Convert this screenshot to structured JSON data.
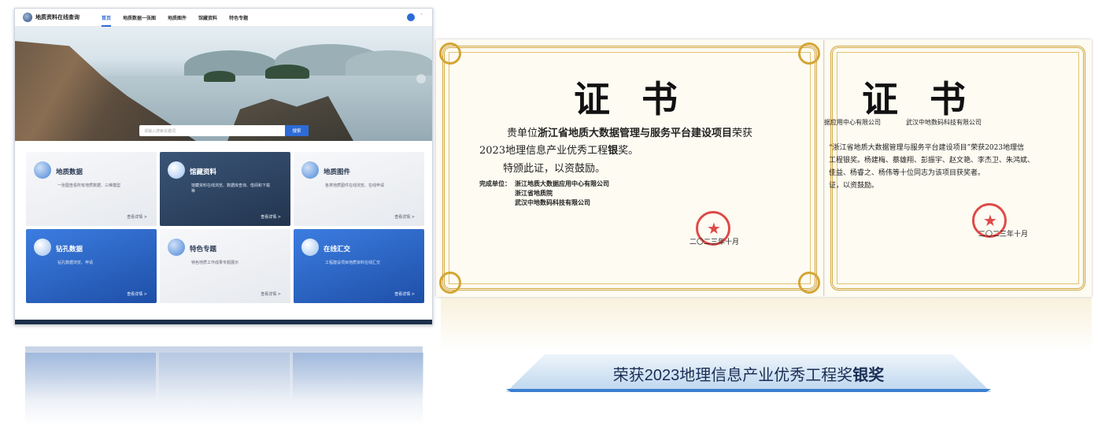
{
  "site": {
    "title": "地质资料在线查询",
    "nav": [
      "首页",
      "地质数据一张图",
      "地质图件",
      "馆藏资料",
      "特色专题"
    ],
    "search_placeholder": "请输入搜索关键词",
    "search_button": "搜索",
    "cards": [
      {
        "title": "地质数据",
        "desc": "一张图查看所有地质数据、三维模型",
        "more": "查看详情 >"
      },
      {
        "title": "馆藏资料",
        "desc": "馆藏资料在线浏览、数据库查询、借阅和下载等",
        "more": "查看详情 >"
      },
      {
        "title": "地质图件",
        "desc": "各类地质图件在线浏览、在线申请",
        "more": "查看详情 >"
      },
      {
        "title": "钻孔数据",
        "desc": "钻孔数据浏览、申请",
        "more": "查看详情 >"
      },
      {
        "title": "特色专题",
        "desc": "特色地质工作成果专题展示",
        "more": "查看详情 >"
      },
      {
        "title": "在线汇交",
        "desc": "工程建设项目地质资料在线汇交",
        "more": "查看详情 >"
      }
    ]
  },
  "cert1": {
    "title": "证书",
    "line1_prefix": "贵单位",
    "line1_bold": "浙江省地质大数据管理与服务平台建设项目",
    "line1_suffix": "荣获",
    "line2_prefix": "2023地理信息产业优秀工程",
    "line2_bold": "银",
    "line2_suffix": "奖。",
    "line3": "特颁此证，以资鼓励。",
    "unit_label": "完成单位：",
    "units": [
      "浙江地质大数据应用中心有限公司",
      "浙江省地质院",
      "武汉中地数码科技有限公司"
    ],
    "date": "二〇二三年十月"
  },
  "cert2": {
    "title": "证书",
    "row1": "据应用中心有限公司　　　　武汉中地数码科技有限公司",
    "row2": "“浙江省地质大数据管理与服务平台建设项目”荣获2023地理信",
    "row3": "工程银奖。杨建梅、蔡雄翔、彭振宇、赵文艳、李杰卫、朱鸿斌、",
    "row4": "佳益、杨睿之、杨伟等十位同志为该项目获奖者。",
    "row5": "证，以资鼓励。",
    "date": "二〇二三年十月"
  },
  "banner": {
    "prefix": "荣获2023地理信息产业优秀工程奖",
    "bold": "银奖"
  }
}
